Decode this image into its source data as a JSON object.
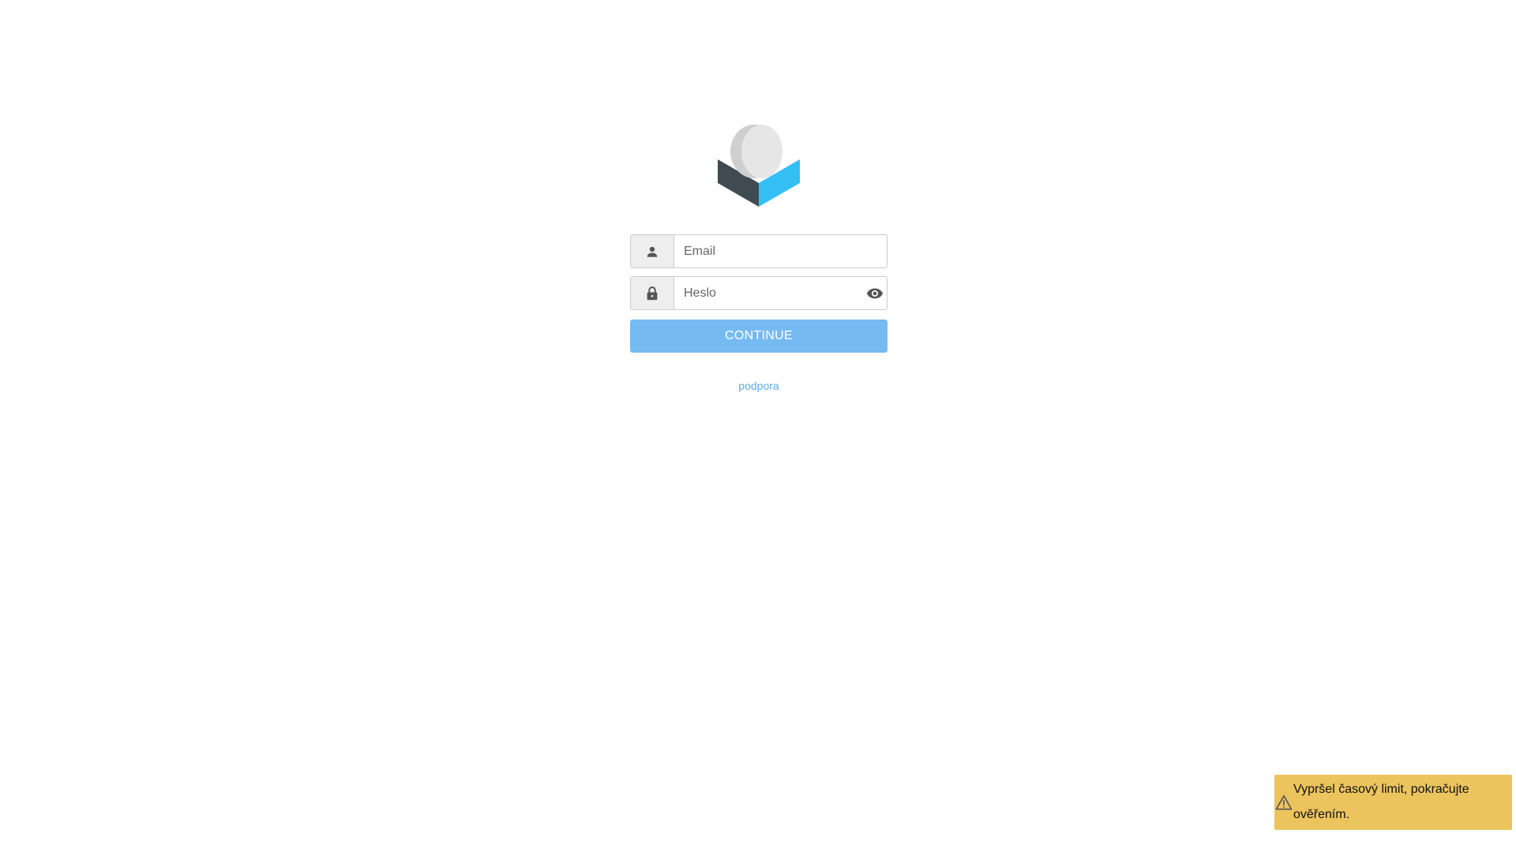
{
  "login": {
    "email_placeholder": "Email",
    "password_placeholder": "Heslo",
    "continue_label": "CONTINUE",
    "support_link": "podpora"
  },
  "icons": {
    "email_addon": "person-icon",
    "password_addon": "lock-icon",
    "password_toggle": "eye-icon",
    "toast": "warning-icon"
  },
  "toast": {
    "message": "Vypršel časový limit, pokračujte ověřením."
  },
  "colors": {
    "button": "#76baf2",
    "link": "#5dade2",
    "toast_background": "#ecc45e",
    "logo_dark": "#3f4b50",
    "logo_blue": "#33bff3",
    "logo_light": "#e3e3e3"
  }
}
